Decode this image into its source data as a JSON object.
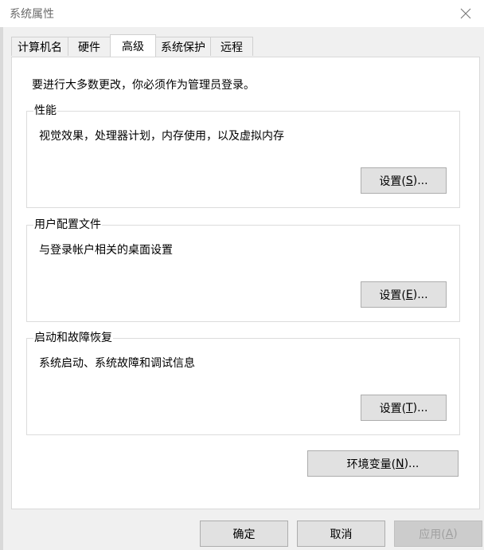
{
  "window": {
    "title": "系统属性"
  },
  "tabs": [
    {
      "label": "计算机名"
    },
    {
      "label": "硬件"
    },
    {
      "label": "高级"
    },
    {
      "label": "系统保护"
    },
    {
      "label": "远程"
    }
  ],
  "notice": "要进行大多数更改，你必须作为管理员登录。",
  "groups": {
    "performance": {
      "title": "性能",
      "desc": "视觉效果，处理器计划，内存使用，以及虚拟内存",
      "button_prefix": "设置(",
      "button_key": "S",
      "button_suffix": ")..."
    },
    "profile": {
      "title": "用户配置文件",
      "desc": "与登录帐户相关的桌面设置",
      "button_prefix": "设置(",
      "button_key": "E",
      "button_suffix": ")..."
    },
    "startup": {
      "title": "启动和故障恢复",
      "desc": "系统启动、系统故障和调试信息",
      "button_prefix": "设置(",
      "button_key": "T",
      "button_suffix": ")..."
    }
  },
  "env_button": {
    "prefix": "环境变量(",
    "key": "N",
    "suffix": ")..."
  },
  "footer": {
    "ok": "确定",
    "cancel": "取消",
    "apply_prefix": "应用(",
    "apply_key": "A",
    "apply_suffix": ")"
  }
}
